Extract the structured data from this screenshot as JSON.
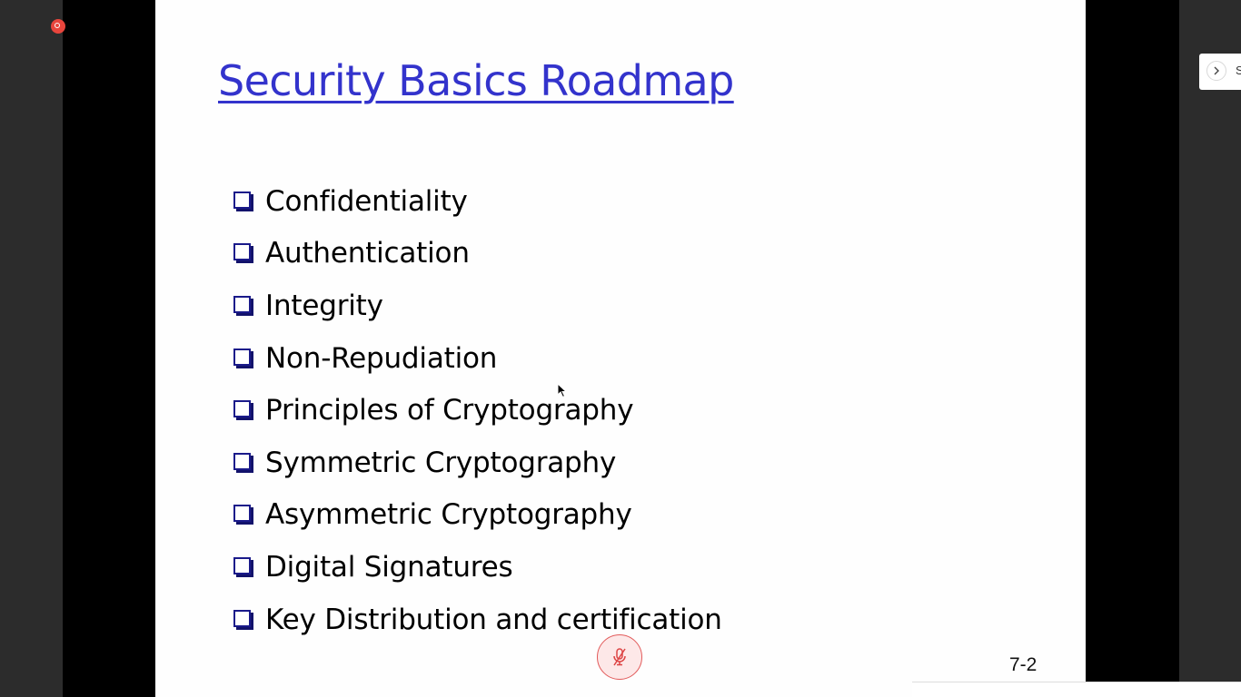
{
  "slide": {
    "title": "Security Basics Roadmap",
    "bullets": [
      "Confidentiality",
      "Authentication",
      "Integrity",
      "Non-Repudiation",
      "Principles of Cryptography",
      "Symmetric Cryptography",
      "Asymmetric Cryptography",
      "Digital Signatures",
      "Key Distribution and certification"
    ],
    "page_number": "7-2"
  },
  "side_panel": {
    "label": "S"
  },
  "colors": {
    "title": "#3333cc",
    "bullet_box": "#1a1a8a",
    "recording": "#e8453c",
    "mic_muted": "#e25a5a"
  },
  "icons": {
    "recording": "recording-indicator-icon",
    "mic": "microphone-muted-icon",
    "toggle": "chevron-right-icon",
    "cursor": "mouse-pointer-icon"
  }
}
